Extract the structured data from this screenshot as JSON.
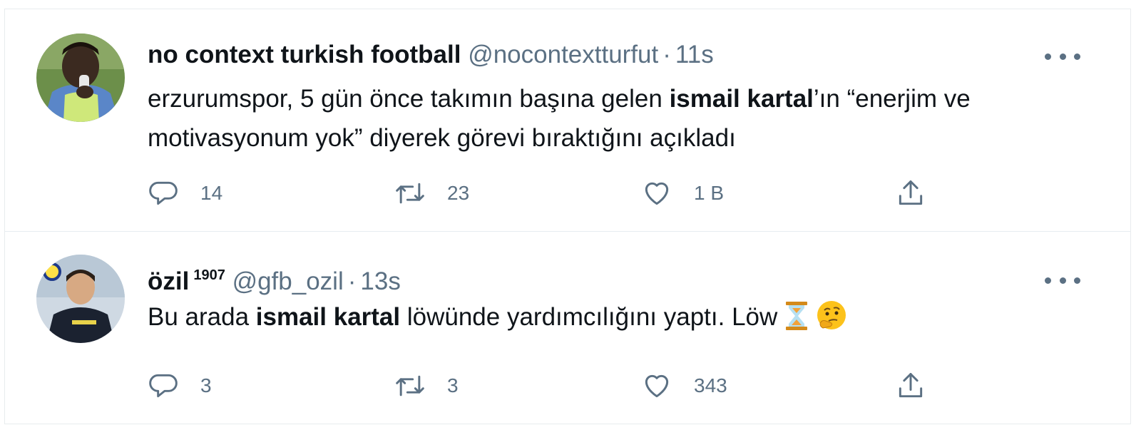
{
  "tweets": [
    {
      "name": "no context turkish football",
      "badge": "",
      "handle": "@nocontextturfut",
      "separator": "·",
      "time": "11s",
      "text": {
        "before": "erzurumspor, 5 gün önce takımın başına gelen ",
        "bold": "ismail kartal",
        "after": "’ın “enerjim ve motivasyonum yok” diyerek görevi bıraktığını açıkladı"
      },
      "emoji": [],
      "replies": "14",
      "retweets": "23",
      "likes": "1 B"
    },
    {
      "name": "özil",
      "badge": "1907",
      "handle": "@gfb_ozil",
      "separator": "·",
      "time": "13s",
      "text": {
        "before": "Bu arada ",
        "bold": "ismail kartal",
        "after": " löwünde yardımcılığını yaptı. Löw "
      },
      "emoji": [
        "hourglass-icon",
        "thinking-face-icon"
      ],
      "replies": "3",
      "retweets": "3",
      "likes": "343"
    }
  ],
  "colors": {
    "text_primary": "#0f1419",
    "text_secondary": "#5b7083",
    "border": "#e6ecf0",
    "background": "#ffffff"
  }
}
